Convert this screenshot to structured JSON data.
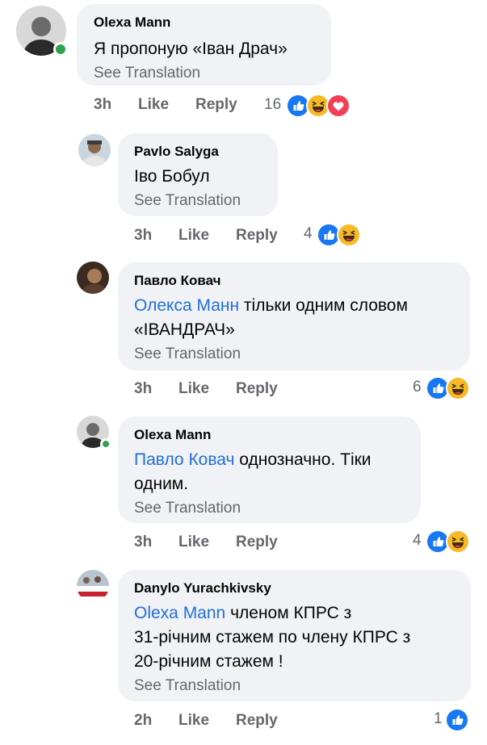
{
  "comments": [
    {
      "author": "Olexa Mann",
      "text": "Я пропоную «Іван Драч»",
      "see_translation": "See Translation",
      "time": "3h",
      "like": "Like",
      "reply": "Reply",
      "reaction_count": "16",
      "reactions": [
        "like-icon",
        "haha-icon",
        "love-icon"
      ],
      "online": true
    },
    {
      "author": "Pavlo Salyga",
      "text": "Іво Бобул",
      "see_translation": "See Translation",
      "time": "3h",
      "like": "Like",
      "reply": "Reply",
      "reaction_count": "4",
      "reactions": [
        "like-icon",
        "haha-icon"
      ]
    },
    {
      "author": "Павло Ковач",
      "mention": "Олекса Манн",
      "text_line1": " тільки одним словом",
      "text_line2": "«ІВАНДРАЧ»",
      "see_translation": "See Translation",
      "time": "3h",
      "like": "Like",
      "reply": "Reply",
      "reaction_count": "6",
      "reactions": [
        "like-icon",
        "haha-icon"
      ]
    },
    {
      "author": "Olexa Mann",
      "mention": "Павло Ковач",
      "text_line1": " однозначно. Тіки",
      "text_line2": "одним.",
      "see_translation": "See Translation",
      "time": "3h",
      "like": "Like",
      "reply": "Reply",
      "reaction_count": "4",
      "reactions": [
        "like-icon",
        "haha-icon"
      ],
      "online": true
    },
    {
      "author": "Danylo Yurachkivsky",
      "mention": "Olexa Mann",
      "text_line1": " членом КПРС з",
      "text_line2": "31-річним стажем по члену КПРС з",
      "text_line3": "20-річним стажем !",
      "see_translation": "See Translation",
      "time": "2h",
      "like": "Like",
      "reply": "Reply",
      "reaction_count": "1",
      "reactions": [
        "like-icon"
      ]
    }
  ],
  "colors": {
    "bubble": "#f0f2f5",
    "mention": "#216fdb",
    "secondary_text": "#65676b",
    "online": "#31a24c",
    "like_blue": "#1877f2",
    "haha_yellow": "#f7b928",
    "love_red": "#f33e58"
  }
}
